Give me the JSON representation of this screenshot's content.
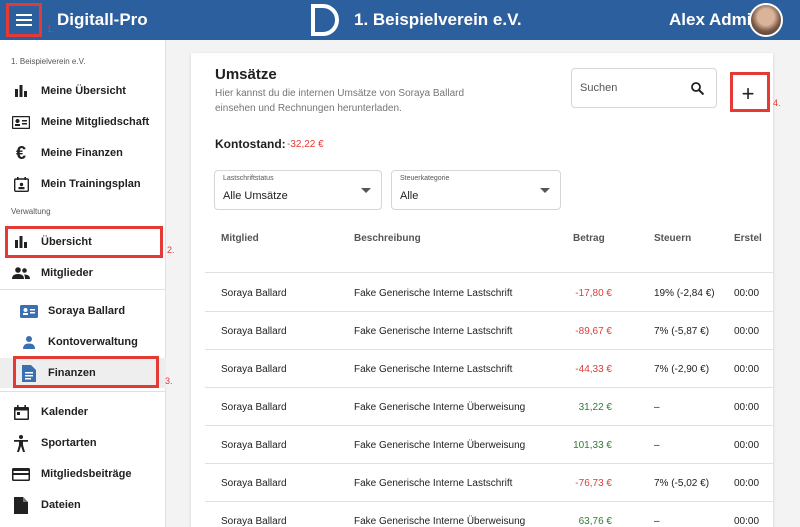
{
  "topbar": {
    "app_title": "Digitall-Pro",
    "club_name": "1. Beispielverein e.V.",
    "user_name": "Alex Admin",
    "menu_icon": "menu-icon",
    "color": "#2c5f9e"
  },
  "sidebar": {
    "club_header": "1. Beispielverein e.V.",
    "admin_header": "Verwaltung",
    "items": [
      {
        "label": "Meine Übersicht",
        "icon": "bar-chart-icon"
      },
      {
        "label": "Meine Mitgliedschaft",
        "icon": "id-card-icon"
      },
      {
        "label": "Meine Finanzen",
        "icon": "euro-icon"
      },
      {
        "label": "Mein Trainingsplan",
        "icon": "calendar-person-icon"
      }
    ],
    "admin_items": [
      {
        "label": "Übersicht",
        "icon": "bar-chart-icon"
      },
      {
        "label": "Mitglieder",
        "icon": "people-icon"
      }
    ],
    "member_items": [
      {
        "label": "Soraya Ballard",
        "icon": "contact-card-icon"
      },
      {
        "label": "Kontoverwaltung",
        "icon": "person-icon"
      },
      {
        "label": "Finanzen",
        "icon": "document-icon"
      }
    ],
    "other_items": [
      {
        "label": "Kalender",
        "icon": "calendar-icon"
      },
      {
        "label": "Sportarten",
        "icon": "sport-icon"
      },
      {
        "label": "Mitgliedsbeiträge",
        "icon": "credit-card-icon"
      },
      {
        "label": "Dateien",
        "icon": "file-icon"
      }
    ]
  },
  "main": {
    "title": "Umsätze",
    "description": "Hier kannst du die internen Umsätze von Soraya Ballard einsehen und Rechnungen herunterladen.",
    "search_placeholder": "Suchen",
    "add_label": "+",
    "balance_label": "Kontostand:",
    "balance_value": "-32,22 €",
    "filters": [
      {
        "label": "Lastschriftstatus",
        "value": "Alle Umsätze"
      },
      {
        "label": "Steuerkategorie",
        "value": "Alle"
      }
    ],
    "columns": [
      "Mitglied",
      "Beschreibung",
      "Betrag",
      "Steuern",
      "Erstel"
    ],
    "rows": [
      {
        "member": "Soraya Ballard",
        "description": "Fake Generische Interne Lastschrift",
        "amount": "-17,80 €",
        "sign": "neg",
        "tax": "19% (-2,84 €)",
        "created": "00:00"
      },
      {
        "member": "Soraya Ballard",
        "description": "Fake Generische Interne Lastschrift",
        "amount": "-89,67 €",
        "sign": "neg",
        "tax": "7% (-5,87 €)",
        "created": "00:00"
      },
      {
        "member": "Soraya Ballard",
        "description": "Fake Generische Interne Lastschrift",
        "amount": "-44,33 €",
        "sign": "neg",
        "tax": "7% (-2,90 €)",
        "created": "00:00"
      },
      {
        "member": "Soraya Ballard",
        "description": "Fake Generische Interne Überweisung",
        "amount": "31,22 €",
        "sign": "pos",
        "tax": "–",
        "created": "00:00"
      },
      {
        "member": "Soraya Ballard",
        "description": "Fake Generische Interne Überweisung",
        "amount": "101,33 €",
        "sign": "pos",
        "tax": "–",
        "created": "00:00"
      },
      {
        "member": "Soraya Ballard",
        "description": "Fake Generische Interne Lastschrift",
        "amount": "-76,73 €",
        "sign": "neg",
        "tax": "7% (-5,02 €)",
        "created": "00:00"
      },
      {
        "member": "Soraya Ballard",
        "description": "Fake Generische Interne Überweisung",
        "amount": "63,76 €",
        "sign": "pos",
        "tax": "–",
        "created": "00:00"
      }
    ]
  },
  "annotations": [
    "1.",
    "2.",
    "3.",
    "4."
  ],
  "colors": {
    "negative": "#e53935",
    "positive": "#2e7d32",
    "annotation": "#e53935"
  }
}
